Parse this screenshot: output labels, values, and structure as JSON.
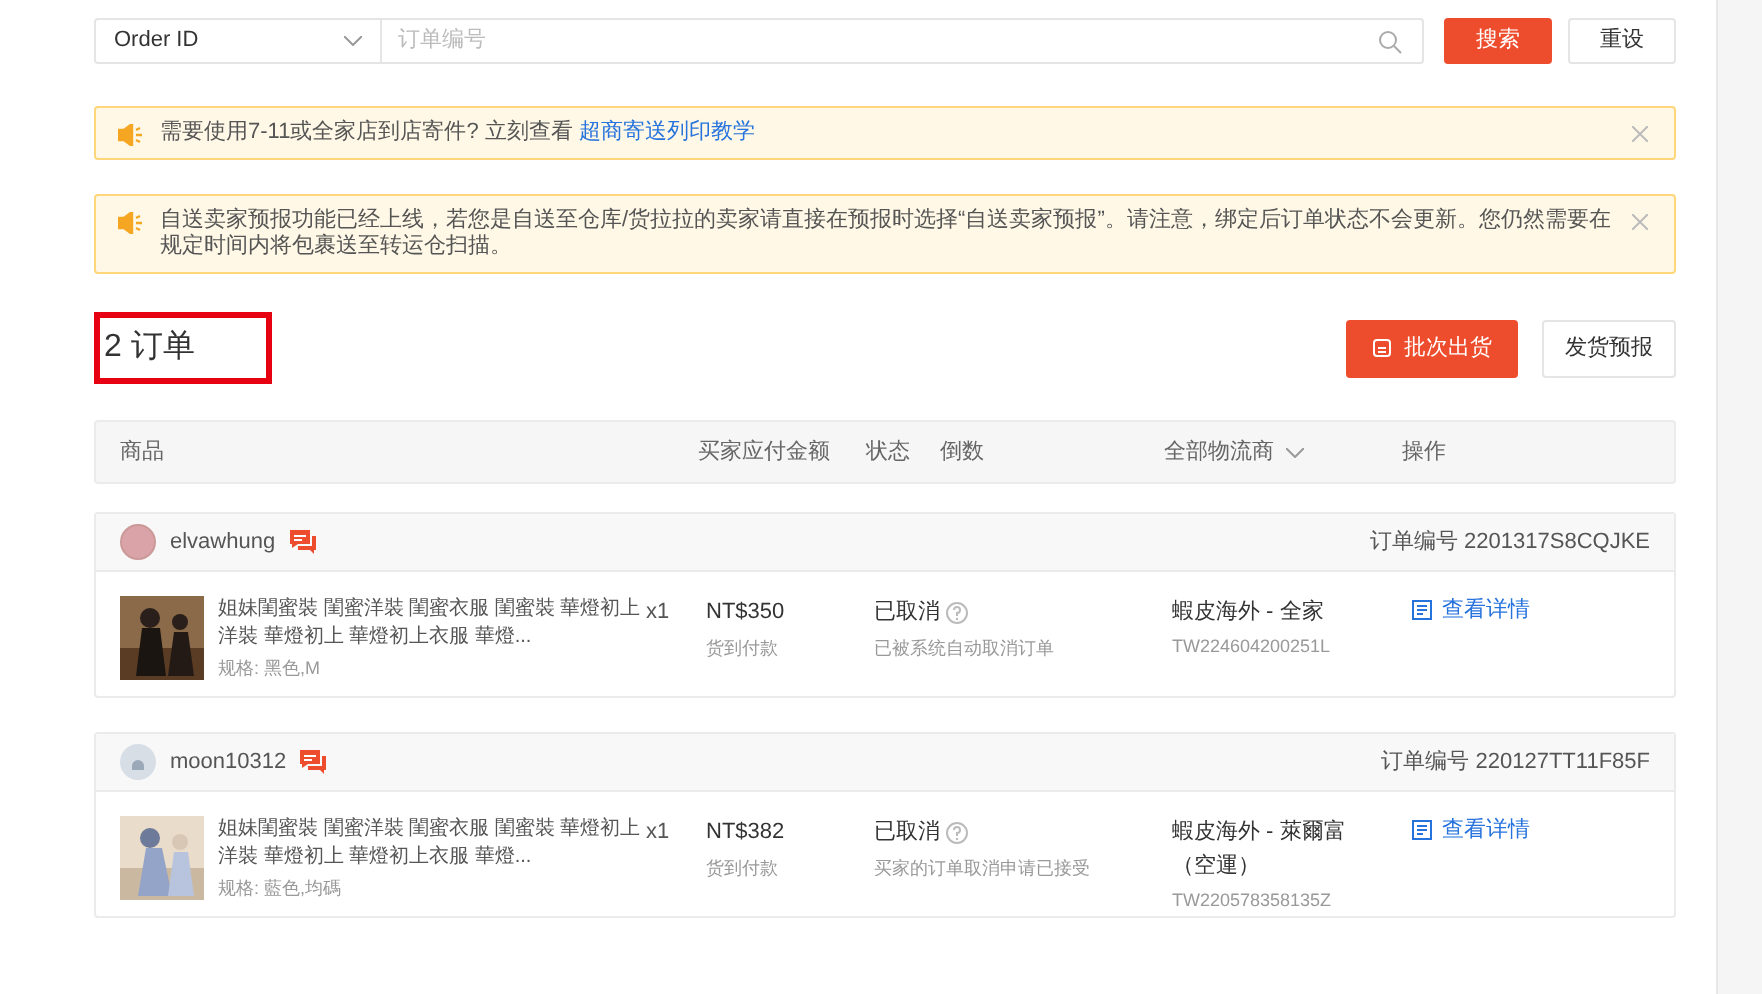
{
  "search": {
    "field_select": "Order ID",
    "placeholder": "订单编号",
    "search_button": "搜索",
    "reset_button": "重设"
  },
  "notices": [
    {
      "text": "需要使用7-11或全家店到店寄件? 立刻查看",
      "link": "超商寄送列印教学"
    },
    {
      "text": "自送卖家预报功能已经上线，若您是自送至仓库/货拉拉的卖家请直接在预报时选择“自送卖家预报”。请注意，绑定后订单状态不会更新。您仍然需要在规定时间内将包裹送至转运仓扫描。"
    }
  ],
  "order_count": {
    "text": "2 订单",
    "highlighted": true
  },
  "actions": {
    "batch_ship": "批次出货",
    "forecast": "发货预报"
  },
  "table": {
    "columns": [
      "商品",
      "买家应付金额",
      "状态",
      "倒数",
      "全部物流商",
      "操作"
    ],
    "orders": [
      {
        "buyer": "elvawhung",
        "order_no": "订单编号 2201317S8CQJKE",
        "product": "姐妹閨蜜裝 閨蜜洋裝 閨蜜衣服 閨蜜裝 華燈初上洋裝 華燈初上 華燈初上衣服 華燈...",
        "spec": "规格: 黑色,M",
        "qty": "x1",
        "price": "NT$350",
        "payment": "货到付款",
        "status": "已取消",
        "status_note": "已被系统自动取消订单",
        "carrier": "蝦皮海外 - 全家",
        "tracking": "TW224604200251L",
        "detail": "查看详情"
      },
      {
        "buyer": "moon10312",
        "avatar": {
          "kind": "default"
        },
        "order_no": "订单编号 220127TT11F85F",
        "product": "姐妹閨蜜裝 閨蜜洋裝 閨蜜衣服 閨蜜裝 華燈初上洋裝 華燈初上 華燈初上衣服 華燈...",
        "spec": "规格: 藍色,均碼",
        "qty": "x1",
        "price": "NT$382",
        "payment": "货到付款",
        "status": "已取消",
        "status_note": "买家的订单取消申请已接受",
        "carrier": "蝦皮海外 - 萊爾富（空運）",
        "tracking": "TW220578358135Z",
        "detail": "查看详情"
      }
    ]
  }
}
